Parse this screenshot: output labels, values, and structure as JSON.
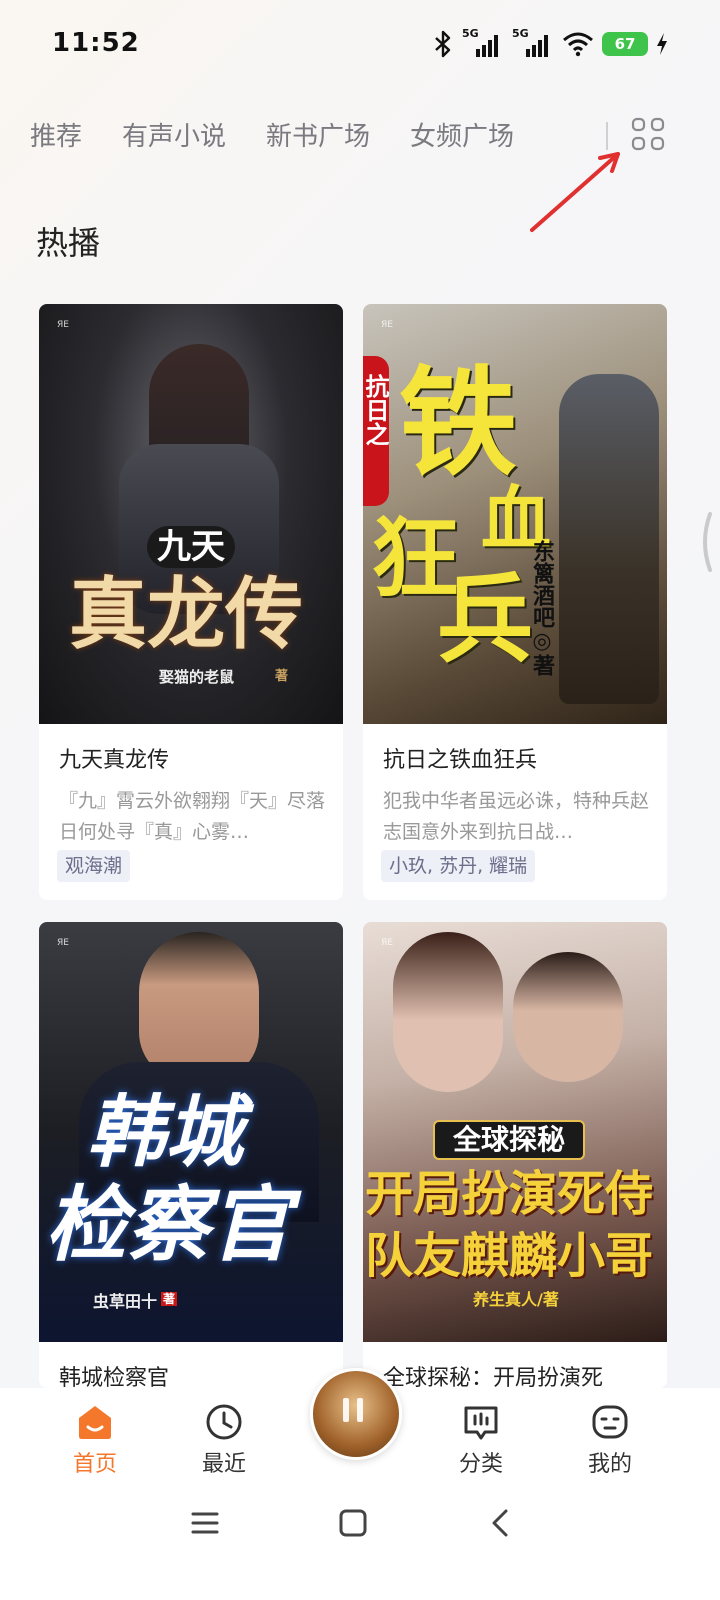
{
  "status_bar": {
    "time": "11:52",
    "signal1": "5G",
    "signal2": "5G",
    "battery": "67",
    "icons": [
      "bluetooth-icon",
      "signal-icon",
      "signal-icon",
      "wifi-icon",
      "battery-icon",
      "charging-icon"
    ]
  },
  "tabs": [
    {
      "label": "推荐"
    },
    {
      "label": "有声小说"
    },
    {
      "label": "新书广场"
    },
    {
      "label": "女频广场"
    }
  ],
  "section": {
    "title": "热播"
  },
  "books": [
    {
      "title": "九天真龙传",
      "description": "『九』霄云外欲翱翔『天』尽落日何处寻『真』心雾…",
      "tag": "观海潮",
      "cover_title_small": "九天",
      "cover_title_big": "真龙传",
      "cover_author": "娶猫的老鼠",
      "cover_author_suffix": "著"
    },
    {
      "title": "抗日之铁血狂兵",
      "description": "犯我中华者虽远必诛，特种兵赵志国意外来到抗日战…",
      "tag": "小玖, 苏丹, 耀瑞",
      "cover_title_side": "抗日之",
      "cover_title_big1": "铁",
      "cover_title_big2": "狂",
      "cover_title_big3": "兵",
      "cover_title_big4": "血",
      "cover_author": "东篱酒吧◎著"
    },
    {
      "title": "韩城检察官",
      "cover_title_line1": "韩城",
      "cover_title_line2": "检察官",
      "cover_author": "虫草田十",
      "cover_author_suffix": "著"
    },
    {
      "title": "全球探秘：开局扮演死",
      "cover_banner": "全球探秘",
      "cover_title_line1": "开局扮演死侍",
      "cover_title_line2": "队友麒麟小哥",
      "cover_author": "养生真人/著"
    }
  ],
  "bottom_nav": {
    "items": [
      {
        "label": "首页",
        "icon": "home-icon"
      },
      {
        "label": "最近",
        "icon": "clock-icon"
      },
      {
        "label": "分类",
        "icon": "category-icon"
      },
      {
        "label": "我的",
        "icon": "profile-icon"
      }
    ],
    "player_icon": "pause-icon"
  },
  "system_nav": [
    "menu-icon",
    "home-square-icon",
    "back-icon"
  ],
  "colors": {
    "accent": "#f4772b",
    "annotation_arrow": "#e03030"
  }
}
